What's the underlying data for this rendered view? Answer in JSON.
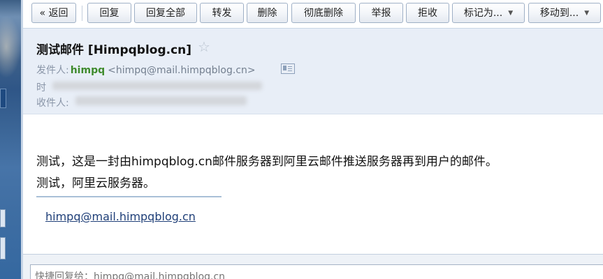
{
  "toolbar": {
    "back": "« 返回",
    "reply": "回复",
    "reply_all": "回复全部",
    "forward": "转发",
    "delete": "删除",
    "delete_permanently": "彻底删除",
    "report": "举报",
    "reject": "拒收",
    "mark_as": "标记为...",
    "move_to": "移动到..."
  },
  "mail": {
    "subject": "测试邮件 [Himpqblog.cn]",
    "from_label": "发件人:",
    "sender_name": "himpq",
    "sender_address": "<himpq@mail.himpqblog.cn>",
    "date_label": "时",
    "to_label": "收件人:",
    "body_line1": "测试，这是一封由himpqblog.cn邮件服务器到阿里云邮件推送服务器再到用户的邮件。",
    "body_line2": "测试，阿里云服务器。",
    "signature_link": "himpq@mail.himpqblog.cn"
  },
  "quick_reply": {
    "placeholder": "快捷回复给：himpq@mail.himpqblog.cn"
  },
  "icons": {
    "star": "star-outline-icon",
    "contact_card": "contact-card-icon"
  },
  "colors": {
    "sender_name": "#3f8b2d",
    "header_bg": "#e8eef7",
    "link": "#1f3f78"
  }
}
